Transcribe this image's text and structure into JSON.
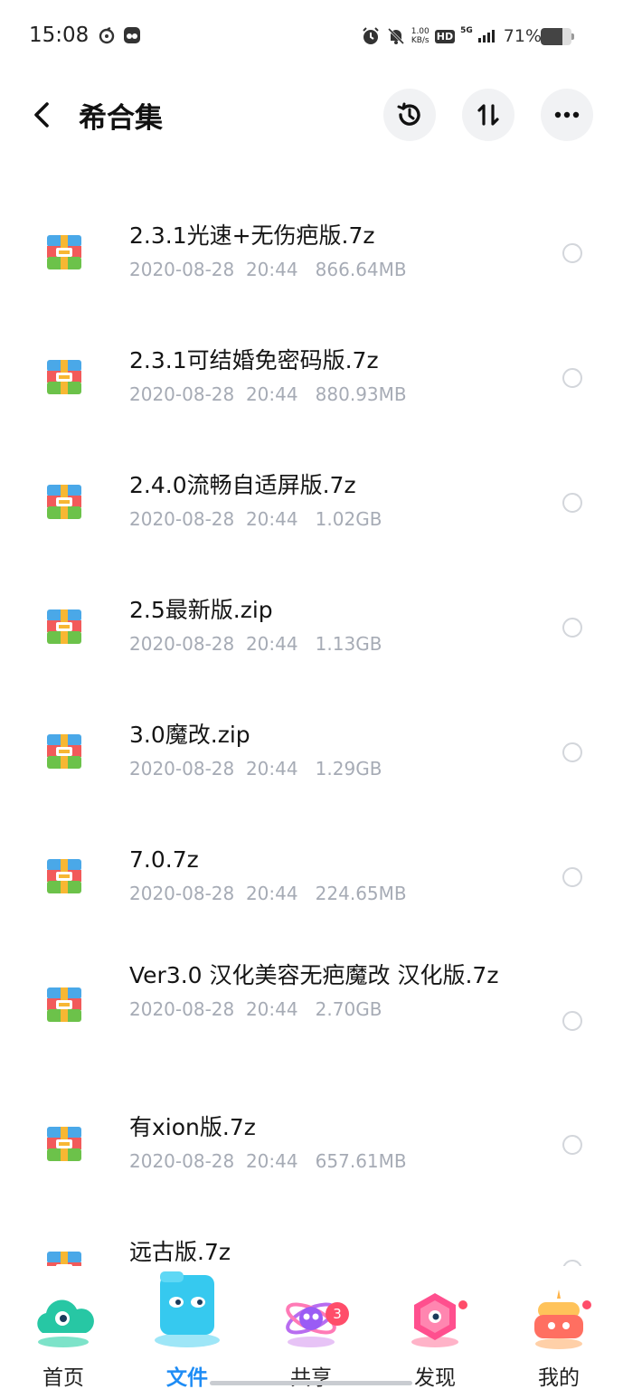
{
  "status_bar": {
    "time": "15:08",
    "net_speed_value": "1.00",
    "net_speed_unit": "KB/s",
    "hd_label": "HD",
    "network_label": "5G",
    "battery_percent_label": "71%",
    "battery_level": 0.71
  },
  "header": {
    "title": "希合集"
  },
  "files": [
    {
      "name": "2.3.1光速+无伤疤版.7z",
      "date": "2020-08-28",
      "time": "20:44",
      "size": "866.64MB"
    },
    {
      "name": "2.3.1可结婚免密码版.7z",
      "date": "2020-08-28",
      "time": "20:44",
      "size": "880.93MB"
    },
    {
      "name": "2.4.0流畅自适屏版.7z",
      "date": "2020-08-28",
      "time": "20:44",
      "size": "1.02GB"
    },
    {
      "name": "2.5最新版.zip",
      "date": "2020-08-28",
      "time": "20:44",
      "size": "1.13GB"
    },
    {
      "name": "3.0魔改.zip",
      "date": "2020-08-28",
      "time": "20:44",
      "size": "1.29GB"
    },
    {
      "name": "7.0.7z",
      "date": "2020-08-28",
      "time": "20:44",
      "size": "224.65MB"
    },
    {
      "name": "Ver3.0 汉化美容无疤魔改 汉化版.7z",
      "date": "2020-08-28",
      "time": "20:44",
      "size": "2.70GB"
    },
    {
      "name": "有xion版.7z",
      "date": "2020-08-28",
      "time": "20:44",
      "size": "657.61MB"
    },
    {
      "name": "远古版.7z",
      "date": "",
      "time": "",
      "size": ""
    }
  ],
  "bottom_nav": {
    "items": [
      {
        "label": "首页",
        "icon": "home-cloud-icon"
      },
      {
        "label": "文件",
        "icon": "files-folder-icon",
        "active": true
      },
      {
        "label": "共享",
        "icon": "share-atom-icon",
        "badge": "3"
      },
      {
        "label": "发现",
        "icon": "discover-hexagon-icon"
      },
      {
        "label": "我的",
        "icon": "profile-cake-icon"
      }
    ]
  },
  "colors": {
    "accent": "#1e8cf5",
    "meta_text": "#a6abb5",
    "badge": "#ff4d6a",
    "header_button_bg": "#f1f2f4"
  }
}
